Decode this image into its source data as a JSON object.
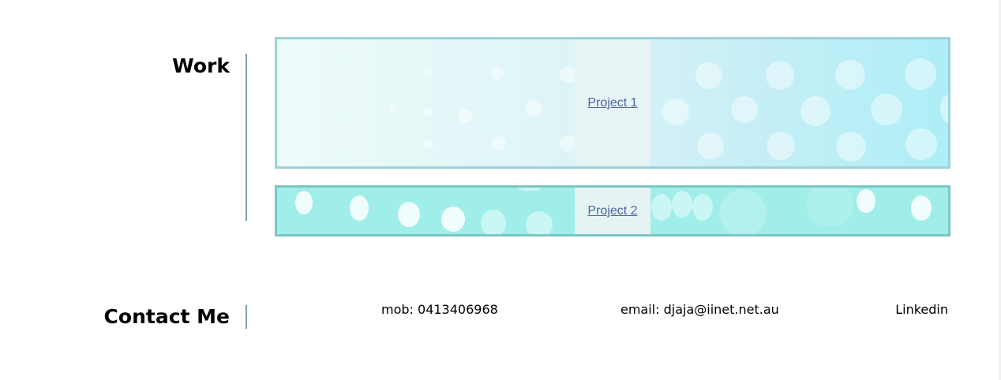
{
  "work": {
    "heading": "Work",
    "projects": [
      {
        "label": "Project 1"
      },
      {
        "label": "Project 2"
      }
    ]
  },
  "contact": {
    "heading": "Contact Me",
    "mob": "mob: 0413406968",
    "email": "email: djaja@iinet.net.au",
    "linkedin": "Linkedin"
  },
  "colors": {
    "link": "#4a66a2",
    "divider": "#7e9fae",
    "card1_border": "#9ed2d8",
    "card2_border": "#7cc6c6",
    "card2_fill": "#9feee9"
  }
}
